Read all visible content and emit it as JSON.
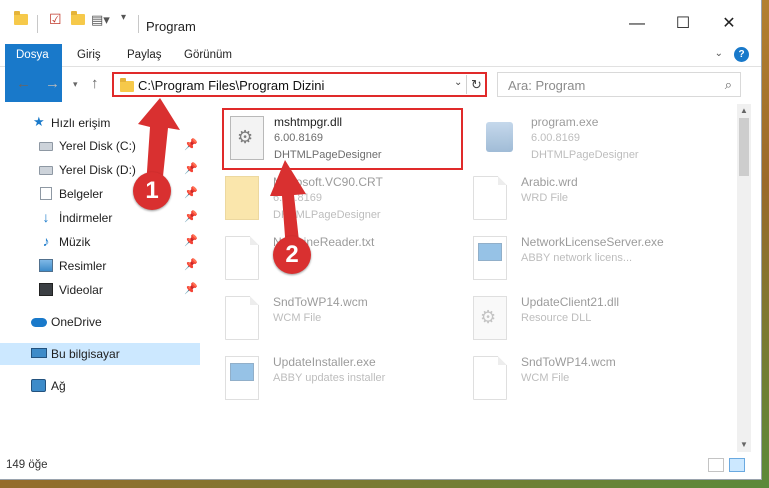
{
  "window": {
    "title": "Program",
    "controls": {
      "minimize": "—",
      "maximize": "☐",
      "close": "✕"
    }
  },
  "ribbon": {
    "tabs": [
      "Dosya",
      "Giriş",
      "Paylaş",
      "Görünüm"
    ],
    "help": "?"
  },
  "address": {
    "path": "C:\\Program Files\\Program Dizini",
    "search_placeholder": "Ara: Program"
  },
  "sidebar": {
    "items": [
      {
        "label": "Hızlı erişim",
        "icon": "star-icon"
      },
      {
        "label": "Yerel Disk (C:)",
        "icon": "drive-icon"
      },
      {
        "label": "Yerel Disk (D:)",
        "icon": "drive-icon"
      },
      {
        "label": "Belgeler",
        "icon": "documents-icon"
      },
      {
        "label": "İndirmeler",
        "icon": "downloads-icon"
      },
      {
        "label": "Müzik",
        "icon": "music-icon"
      },
      {
        "label": "Resimler",
        "icon": "pictures-icon"
      },
      {
        "label": "Videolar",
        "icon": "videos-icon"
      },
      {
        "label": "OneDrive",
        "icon": "cloud-icon"
      },
      {
        "label": "Bu bilgisayar",
        "icon": "computer-icon"
      },
      {
        "label": "Ağ",
        "icon": "network-icon"
      }
    ]
  },
  "files": [
    {
      "name": "mshtmpgr.dll",
      "line2": "6.00.8169",
      "line3": "DHTMLPageDesigner",
      "icon": "dll-icon"
    },
    {
      "name": "program.exe",
      "line2": "6.00.8169",
      "line3": "DHTMLPageDesigner",
      "icon": "exe-icon"
    },
    {
      "name": "Microsoft.VC90.CRT",
      "line2": "6.00.8169",
      "line3": "DHTMLPageDesigner",
      "icon": "folder-icon"
    },
    {
      "name": "Arabic.wrd",
      "line2": "WRD File",
      "line3": "",
      "icon": "file-icon"
    },
    {
      "name": "NewLineReader.txt",
      "line2": "",
      "line3": "",
      "icon": "file-icon"
    },
    {
      "name": "NetworkLicenseServer.exe",
      "line2": "ABBY network licens...",
      "line3": "",
      "icon": "app-icon"
    },
    {
      "name": "SndToWP14.wcm",
      "line2": "WCM File",
      "line3": "",
      "icon": "file-icon"
    },
    {
      "name": "UpdateClient21.dll",
      "line2": "Resource DLL",
      "line3": "",
      "icon": "dll-icon"
    },
    {
      "name": "UpdateInstaller.exe",
      "line2": "ABBY updates installer",
      "line3": "",
      "icon": "app-icon"
    },
    {
      "name": "SndToWP14.wcm",
      "line2": "WCM File",
      "line3": "",
      "icon": "file-icon"
    }
  ],
  "status": {
    "count": "149 öğe"
  },
  "annotations": {
    "badge1": "1",
    "badge2": "2",
    "accent": "#d93030"
  }
}
